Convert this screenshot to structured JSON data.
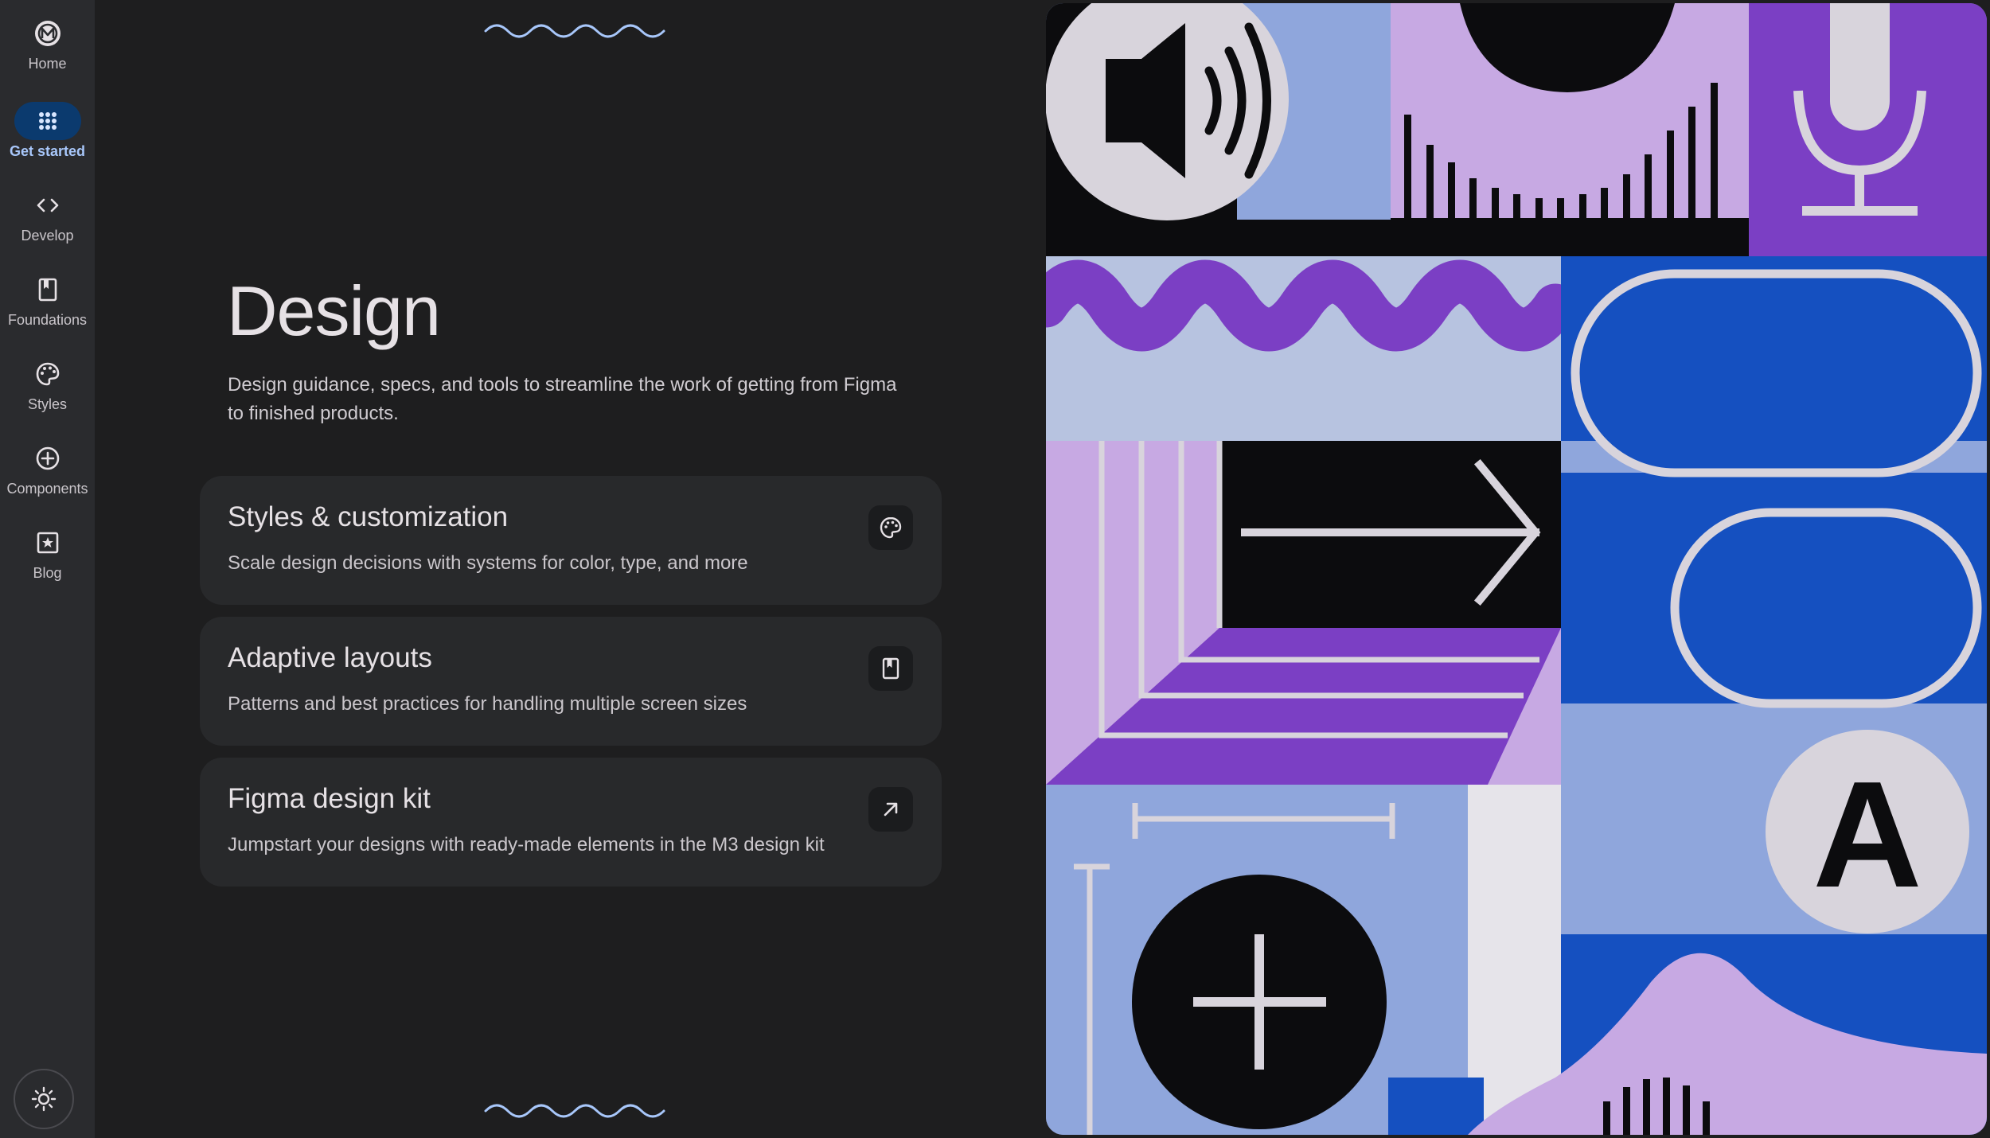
{
  "nav": {
    "items": [
      {
        "label": "Home",
        "icon": "material-logo-icon",
        "active": false
      },
      {
        "label": "Get started",
        "icon": "apps-grid-icon",
        "active": true
      },
      {
        "label": "Develop",
        "icon": "code-icon",
        "active": false
      },
      {
        "label": "Foundations",
        "icon": "book-icon",
        "active": false
      },
      {
        "label": "Styles",
        "icon": "palette-icon",
        "active": false
      },
      {
        "label": "Components",
        "icon": "add-circle-icon",
        "active": false
      },
      {
        "label": "Blog",
        "icon": "star-box-icon",
        "active": false
      }
    ],
    "theme_toggle_icon": "sun-icon"
  },
  "main": {
    "title": "Design",
    "description": "Design guidance, specs, and tools to streamline the work of getting from Figma to finished products.",
    "cards": [
      {
        "title": "Styles & customization",
        "description": "Scale design decisions with systems for color, type, and more",
        "icon": "palette-icon"
      },
      {
        "title": "Adaptive layouts",
        "description": "Patterns and best practices for handling multiple screen sizes",
        "icon": "bookmark-book-icon"
      },
      {
        "title": "Figma design kit",
        "description": "Jumpstart your designs with ready-made elements in the M3 design kit",
        "icon": "arrow-outward-icon"
      }
    ]
  },
  "hero": {
    "letter": "A",
    "icons": [
      "speaker-icon",
      "microphone-icon",
      "arrow-right-icon",
      "plus-icon"
    ]
  },
  "colors": {
    "background": "#1e1e1f",
    "rail": "#2a2b2e",
    "card": "#28292b",
    "accent": "#a8c7fa",
    "active_pill": "#0b3a6e",
    "illustration_purple": "#7b3fc4",
    "illustration_lilac": "#c7a9e3",
    "illustration_blue": "#1550c0",
    "illustration_periwinkle": "#8fa6dc"
  }
}
